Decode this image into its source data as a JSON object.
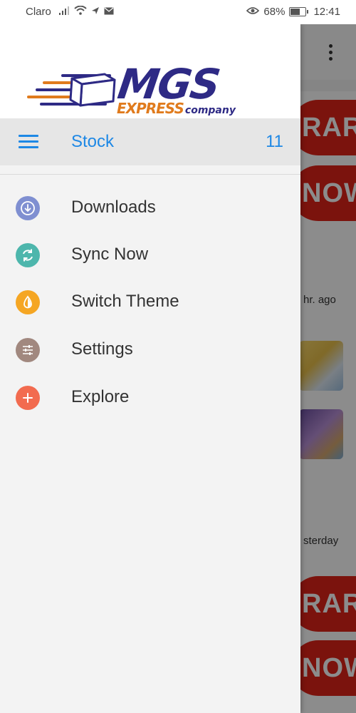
{
  "status_bar": {
    "carrier": "Claro",
    "battery": "68%",
    "time": "12:41"
  },
  "background": {
    "promo_1": "RAR",
    "promo_2": "NOW",
    "time_1": "hr. ago",
    "time_2": "sterday",
    "promo_3": "RAR",
    "promo_4": "NOW"
  },
  "drawer": {
    "logo": {
      "main": "MGS",
      "sub": "EXPRESS",
      "tag": "company"
    },
    "active_item": {
      "label": "Stock",
      "count": "11",
      "icon": "hamburger-icon"
    },
    "menu": [
      {
        "label": "Downloads",
        "icon": "download-icon",
        "color": "#7f8fd1"
      },
      {
        "label": "Sync Now",
        "icon": "sync-icon",
        "color": "#4db6ac"
      },
      {
        "label": "Switch Theme",
        "icon": "theme-icon",
        "color": "#f5a623"
      },
      {
        "label": "Settings",
        "icon": "settings-sliders-icon",
        "color": "#a1887f"
      },
      {
        "label": "Explore",
        "icon": "plus-icon",
        "color": "#f26b4f"
      }
    ]
  },
  "colors": {
    "accent": "#1e88e5",
    "logo_blue": "#2e2a85",
    "logo_orange": "#e07b1d"
  }
}
